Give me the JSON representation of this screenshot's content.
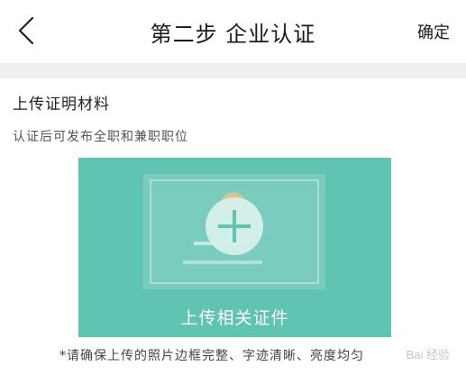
{
  "nav": {
    "back_icon": "chevron-left-icon",
    "title": "第二步 企业认证",
    "confirm_label": "确定"
  },
  "section": {
    "title": "上传证明材料",
    "subtitle": "认证后可发布全职和兼职职位"
  },
  "upload": {
    "label": "上传相关证件",
    "icon": "plus-icon",
    "background_color": "#5fc4b1"
  },
  "notice": {
    "text": "*请确保上传的照片边框完整、字迹清晰、亮度均匀"
  },
  "watermark": {
    "text": "Bai 经验"
  }
}
